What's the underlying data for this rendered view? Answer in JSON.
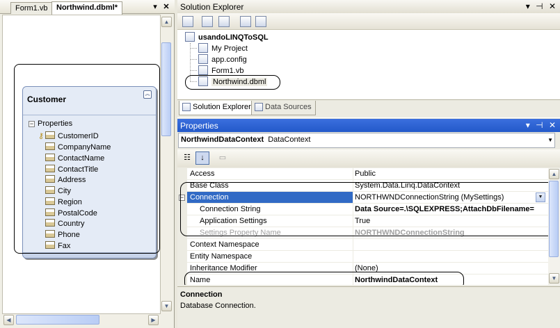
{
  "designer": {
    "tabs": [
      {
        "label": "Form1.vb",
        "active": false
      },
      {
        "label": "Northwind.dbml*",
        "active": true
      }
    ],
    "entity": {
      "title": "Customer",
      "group_label": "Properties",
      "properties": [
        "CustomerID",
        "CompanyName",
        "ContactName",
        "ContactTitle",
        "Address",
        "City",
        "Region",
        "PostalCode",
        "Country",
        "Phone",
        "Fax"
      ],
      "key_property": "CustomerID"
    }
  },
  "solution_explorer": {
    "title": "Solution Explorer",
    "project": "usandoLINQToSQL",
    "items": [
      "My Project",
      "app.config",
      "Form1.vb",
      "Northwind.dbml"
    ],
    "tabs": [
      {
        "label": "Solution Explorer",
        "active": true
      },
      {
        "label": "Data Sources",
        "active": false
      }
    ]
  },
  "properties": {
    "title": "Properties",
    "object_name": "NorthwindDataContext",
    "object_type": "DataContext",
    "rows": [
      {
        "name": "Access",
        "value": "Public"
      },
      {
        "name": "Base Class",
        "value": "System.Data.Linq.DataContext"
      },
      {
        "name": "Connection",
        "value": "NORTHWNDConnectionString (MySettings)",
        "selected": true,
        "expanded": true
      },
      {
        "name": "Connection String",
        "value": "Data Source=.\\SQLEXPRESS;AttachDbFilename=",
        "child": true,
        "bold": true
      },
      {
        "name": "Application Settings",
        "value": "True",
        "child": true
      },
      {
        "name": "Settings Property Name",
        "value": "NORTHWNDConnectionString",
        "child": true,
        "gray": true
      },
      {
        "name": "Context Namespace",
        "value": ""
      },
      {
        "name": "Entity Namespace",
        "value": ""
      },
      {
        "name": "Inheritance Modifier",
        "value": "(None)"
      },
      {
        "name": "Name",
        "value": "NorthwindDataContext",
        "bold": true
      }
    ],
    "description": {
      "title": "Connection",
      "text": "Database Connection."
    }
  },
  "colors": {
    "active_title": "#2359c9",
    "selection": "#316ac5",
    "entity_fill": "#e4ebf6"
  },
  "icons": [
    "properties-window-icon",
    "show-all-files-icon",
    "refresh-icon",
    "view-code-icon",
    "view-designer-icon",
    "categorized-icon",
    "alphabetical-icon",
    "property-pages-icon",
    "key-icon",
    "column-icon"
  ]
}
